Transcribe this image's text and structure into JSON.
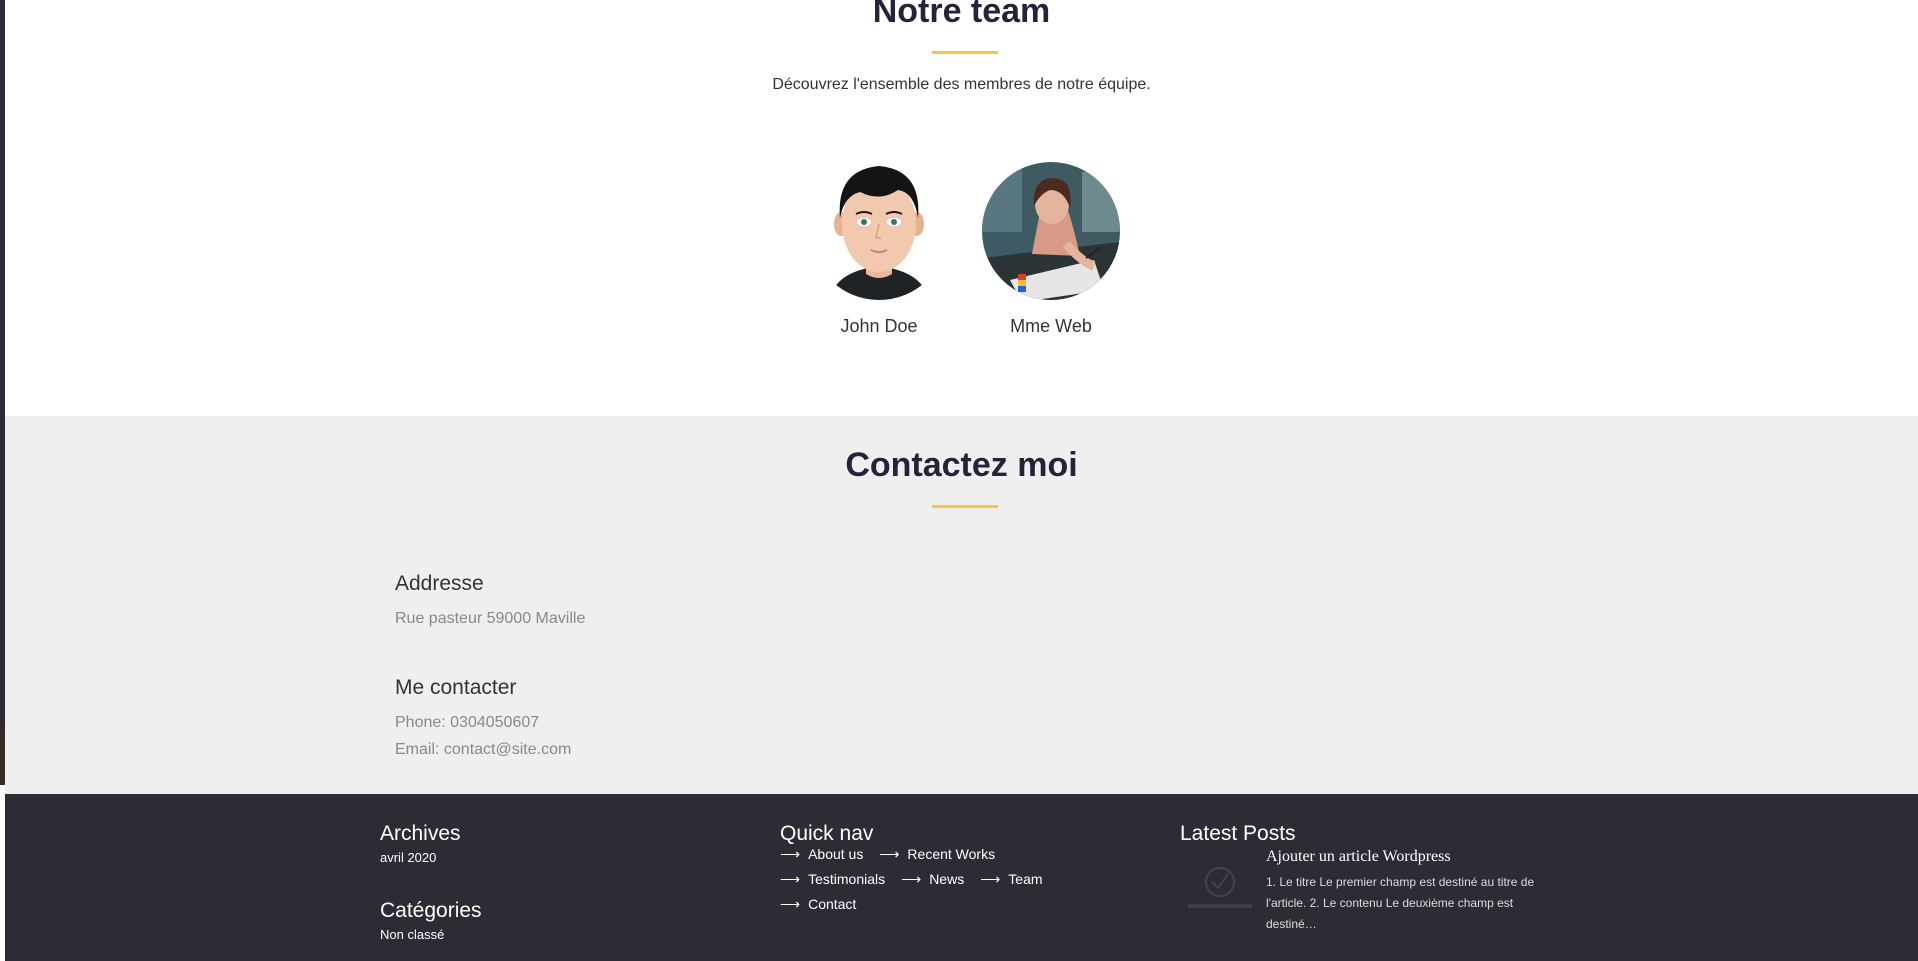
{
  "team": {
    "title": "Notre team",
    "subtitle": "Découvrez l'ensemble des membres de notre équipe.",
    "members": [
      {
        "name": "John Doe"
      },
      {
        "name": "Mme Web"
      }
    ]
  },
  "contact": {
    "title": "Contactez moi",
    "address_heading": "Addresse",
    "address": "Rue pasteur 59000 Maville",
    "contact_heading": "Me contacter",
    "phone": "Phone: 0304050607",
    "email": "Email: contact@site.com"
  },
  "footer": {
    "archives_heading": "Archives",
    "archives": [
      "avril 2020"
    ],
    "categories_heading": "Catégories",
    "categories": [
      "Non classé"
    ],
    "quicknav_heading": "Quick nav",
    "quicknav": [
      "About us",
      "Recent Works",
      "Testimonials",
      "News",
      "Team",
      "Contact"
    ],
    "arrow": "⟶",
    "latest_heading": "Latest Posts",
    "post_title": "Ajouter un article Wordpress",
    "post_excerpt": "1. Le titre Le premier champ est destiné au titre de l'article. 2. Le contenu Le deuxième champ est destiné…"
  },
  "colors": {
    "accent": "#f7c744",
    "footer_bg": "#2c2c34",
    "contact_bg": "#efefef"
  }
}
